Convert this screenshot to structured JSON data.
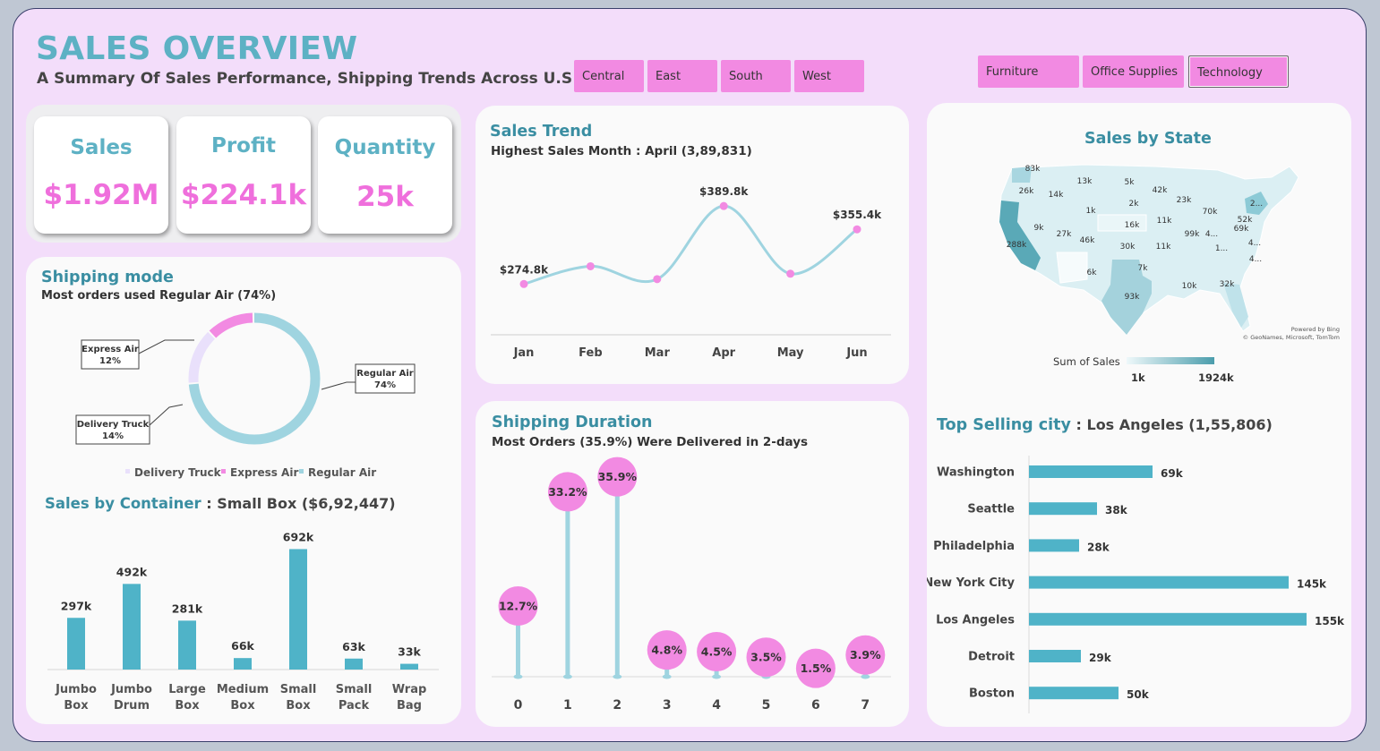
{
  "header": {
    "title": "SALES OVERVIEW",
    "subtitle": "A Summary Of Sales Performance, Shipping Trends Across U.S"
  },
  "region_slicer": [
    "Central",
    "East",
    "South",
    "West"
  ],
  "category_slicer": [
    "Furniture",
    "Office Supplies",
    "Technology"
  ],
  "category_selected": "Technology",
  "kpis": [
    {
      "label": "Sales",
      "value": "$1.92M"
    },
    {
      "label": "Profit",
      "value": "$224.1k"
    },
    {
      "label": "Quantity",
      "value": "25k"
    }
  ],
  "colors": {
    "accent_teal": "#4fb3c8",
    "accent_pink": "#f28ae2",
    "light_teal": "#9fd4e0",
    "title_teal": "#3a8ea2"
  },
  "sales_trend": {
    "title": "Sales Trend",
    "subtitle": "Highest Sales Month : April (3,89,831)"
  },
  "shipping_mode": {
    "title": "Shipping mode",
    "subtitle": "Most orders used Regular Air (74%)",
    "callouts": [
      {
        "name": "Express Air",
        "pct": "12%"
      },
      {
        "name": "Regular Air",
        "pct": "74%"
      },
      {
        "name": "Delivery Truck",
        "pct": "14%"
      }
    ]
  },
  "shipping_duration": {
    "title": "Shipping Duration",
    "subtitle": "Most Orders (35.9%) Were Delivered in 2-days"
  },
  "container": {
    "title": "Sales by Container",
    "subtitle": " : Small Box ($6,92,447)"
  },
  "state_map": {
    "title": "Sales by State",
    "legend_title": "Sum of Sales",
    "legend_min": "1k",
    "legend_max": "1924k",
    "credit_1": "Powered by Bing",
    "credit_2": "© GeoNames, Microsoft, TomTom",
    "labels": [
      "83k",
      "26k",
      "14k",
      "13k",
      "5k",
      "42k",
      "23k",
      "70k",
      "2...",
      "1k",
      "2k",
      "52k",
      "9k",
      "27k",
      "16k",
      "11k",
      "99k",
      "4...",
      "69k",
      "46k",
      "30k",
      "11k",
      "1...",
      "4...",
      "288k",
      "6k",
      "7k",
      "4...",
      "10k",
      "32k",
      "93k"
    ]
  },
  "top_city": {
    "title": "Top Selling city",
    "subtitle": " : Los Angeles (1,55,806)"
  },
  "chart_data": [
    {
      "type": "line",
      "title": "Sales Trend",
      "categories": [
        "Jan",
        "Feb",
        "Mar",
        "Apr",
        "May",
        "Jun"
      ],
      "values": [
        274800,
        301000,
        282000,
        389800,
        290000,
        355400
      ],
      "data_labels": [
        "$274.8k",
        "",
        "",
        "$389.8k",
        "",
        "$355.4k"
      ]
    },
    {
      "type": "pie",
      "title": "Shipping mode",
      "labels": [
        "Delivery Truck",
        "Express Air",
        "Regular Air"
      ],
      "values": [
        14,
        12,
        74
      ],
      "legend_position": "bottom"
    },
    {
      "type": "bar",
      "title": "Sales by Container",
      "categories": [
        "Jumbo Box",
        "Jumbo Drum",
        "Large Box",
        "Medium Box",
        "Small Box",
        "Small Pack",
        "Wrap Bag"
      ],
      "category_lines": [
        [
          "Jumbo",
          "Box"
        ],
        [
          "Jumbo",
          "Drum"
        ],
        [
          "Large",
          "Box"
        ],
        [
          "Medium",
          "Box"
        ],
        [
          "Small",
          "Box"
        ],
        [
          "Small",
          "Pack"
        ],
        [
          "Wrap",
          "Bag"
        ]
      ],
      "values": [
        297,
        492,
        281,
        66,
        692,
        63,
        33
      ],
      "data_labels": [
        "297k",
        "492k",
        "281k",
        "66k",
        "692k",
        "63k",
        "33k"
      ],
      "ylim": [
        0,
        720
      ]
    },
    {
      "type": "bar",
      "title": "Shipping Duration",
      "categories": [
        "0",
        "1",
        "2",
        "3",
        "4",
        "5",
        "6",
        "7"
      ],
      "values": [
        12.7,
        33.2,
        35.9,
        4.8,
        4.5,
        3.5,
        1.5,
        3.9
      ],
      "data_labels": [
        "12.7%",
        "33.2%",
        "35.9%",
        "4.8%",
        "4.5%",
        "3.5%",
        "1.5%",
        "3.9%"
      ],
      "ylim": [
        0,
        36
      ]
    },
    {
      "type": "bar",
      "title": "Top Selling city",
      "orientation": "horizontal",
      "categories": [
        "Washington",
        "Seattle",
        "Philadelphia",
        "New York City",
        "Los Angeles",
        "Detroit",
        "Boston"
      ],
      "values": [
        69,
        38,
        28,
        145,
        155,
        29,
        50
      ],
      "data_labels": [
        "69k",
        "38k",
        "28k",
        "145k",
        "155k",
        "29k",
        "50k"
      ],
      "xlim": [
        0,
        160
      ]
    }
  ]
}
